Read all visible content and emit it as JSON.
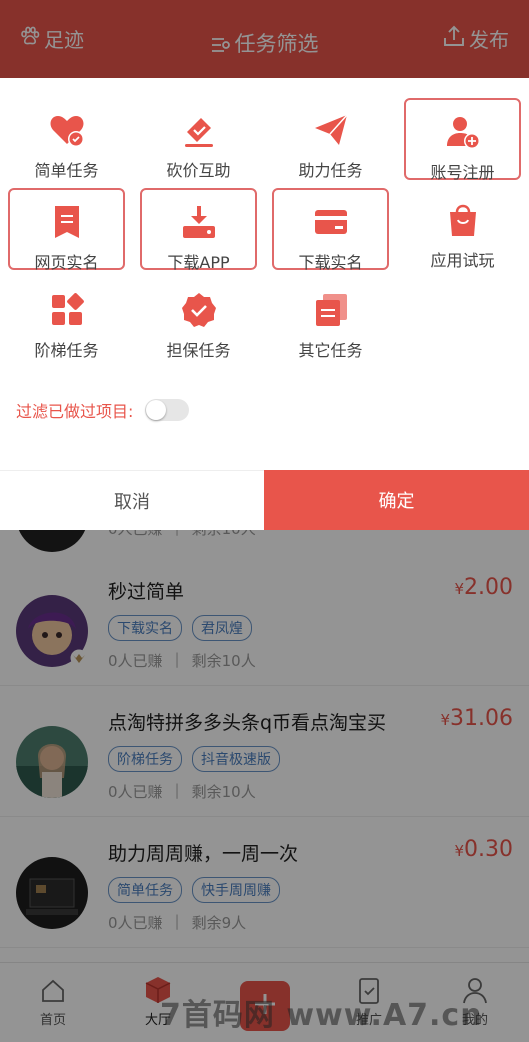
{
  "header": {
    "left_label": "足迹",
    "title": "任务筛选",
    "right_label": "发布"
  },
  "categories": [
    {
      "label": "简单任务",
      "icon": "heart-check-icon",
      "selected": false
    },
    {
      "label": "砍价互助",
      "icon": "tag-check-icon",
      "selected": false
    },
    {
      "label": "助力任务",
      "icon": "paper-plane-icon",
      "selected": false
    },
    {
      "label": "账号注册",
      "icon": "user-add-icon",
      "selected": true
    },
    {
      "label": "网页实名",
      "icon": "bookmark-doc-icon",
      "selected": true
    },
    {
      "label": "下载APP",
      "icon": "download-tray-icon",
      "selected": true
    },
    {
      "label": "下载实名",
      "icon": "card-icon",
      "selected": true
    },
    {
      "label": "应用试玩",
      "icon": "shopping-bag-icon",
      "selected": false
    },
    {
      "label": "阶梯任务",
      "icon": "grid-blocks-icon",
      "selected": false
    },
    {
      "label": "担保任务",
      "icon": "badge-check-icon",
      "selected": false
    },
    {
      "label": "其它任务",
      "icon": "stacked-docs-icon",
      "selected": false
    }
  ],
  "filter": {
    "label": "过滤已做过项目:",
    "enabled": false
  },
  "actions": {
    "cancel": "取消",
    "confirm": "确定"
  },
  "partial_row": {
    "earned": "0人已赚",
    "remaining": "剩余10人"
  },
  "tasks": [
    {
      "title": "秒过简单",
      "price": "2.00",
      "currency": "¥",
      "tags": [
        "下载实名",
        "君凤煌"
      ],
      "earned": "0人已赚",
      "remaining": "剩余10人"
    },
    {
      "title": "点淘特拼多多头条q币看点淘宝买",
      "price": "31.06",
      "currency": "¥",
      "tags": [
        "阶梯任务",
        "抖音极速版"
      ],
      "earned": "0人已赚",
      "remaining": "剩余10人"
    },
    {
      "title": "助力周周赚，一周一次",
      "price": "0.30",
      "currency": "¥",
      "tags": [
        "简单任务",
        "快手周周赚"
      ],
      "earned": "0人已赚",
      "remaining": "剩余9人"
    }
  ],
  "nav": {
    "home": "首页",
    "hall": "大厅",
    "promote": "推广",
    "mine": "我的"
  },
  "watermark": "7首码网   www.A7.cn",
  "colors": {
    "brand": "#e8554b",
    "tag_blue": "#4b7fbf",
    "selected_border": "#e06a6a"
  }
}
